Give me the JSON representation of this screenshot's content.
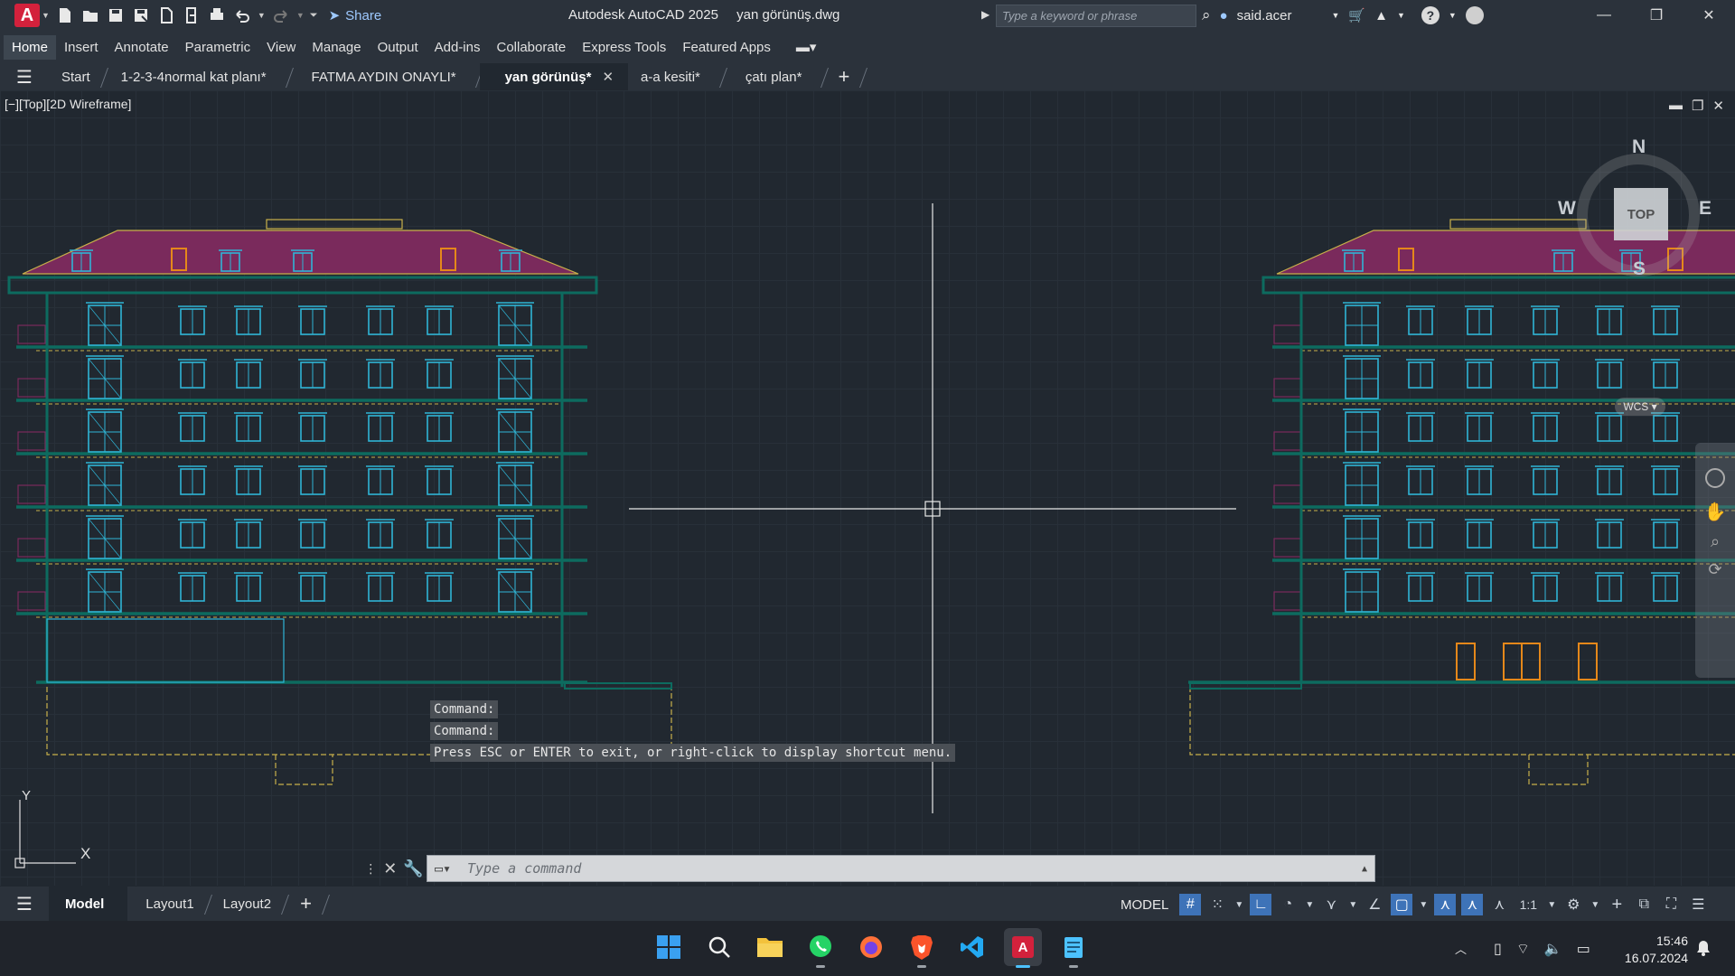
{
  "titlebar": {
    "logo_letter": "A",
    "share_label": "Share",
    "app_name": "Autodesk AutoCAD 2025",
    "file_name": "yan görünüş.dwg",
    "search_placeholder": "Type a keyword or phrase",
    "user_name": "said.acer"
  },
  "ribbon_tabs": [
    "Home",
    "Insert",
    "Annotate",
    "Parametric",
    "View",
    "Manage",
    "Output",
    "Add-ins",
    "Collaborate",
    "Express Tools",
    "Featured Apps"
  ],
  "file_tabs": [
    {
      "label": "Start"
    },
    {
      "label": "1-2-3-4normal kat planı*"
    },
    {
      "label": "FATMA AYDIN ONAYLI*"
    },
    {
      "label": "yan görünüş*",
      "active": true
    },
    {
      "label": "a-a kesiti*"
    },
    {
      "label": "çatı plan*"
    }
  ],
  "viewport": {
    "label": "[−][Top][2D Wireframe]",
    "viewcube_face": "TOP",
    "compass": {
      "n": "N",
      "s": "S",
      "e": "E",
      "w": "W"
    },
    "wcs_label": "WCS",
    "ucs_x": "X",
    "ucs_y": "Y"
  },
  "command": {
    "history": [
      "Command:",
      "Command:",
      "Press ESC or ENTER to exit, or right-click to display shortcut menu."
    ],
    "placeholder": "Type a command"
  },
  "layout_tabs": [
    "Model",
    "Layout1",
    "Layout2"
  ],
  "status": {
    "model_label": "MODEL",
    "scale_label": "1:1"
  },
  "taskbar": {
    "apps": [
      "start-icon",
      "search-icon",
      "file-explorer-icon",
      "whatsapp-icon",
      "firefox-icon",
      "brave-icon",
      "vscode-icon",
      "autocad-icon",
      "notepad-icon"
    ],
    "time": "15:46",
    "date": "16.07.2024"
  },
  "colors": {
    "canvas_bg": "#212830",
    "window_cyan": "#2fb5d6",
    "floor_green": "#0d6b5f",
    "roof_magenta": "#7a2a5c",
    "door_orange": "#e5881a"
  }
}
